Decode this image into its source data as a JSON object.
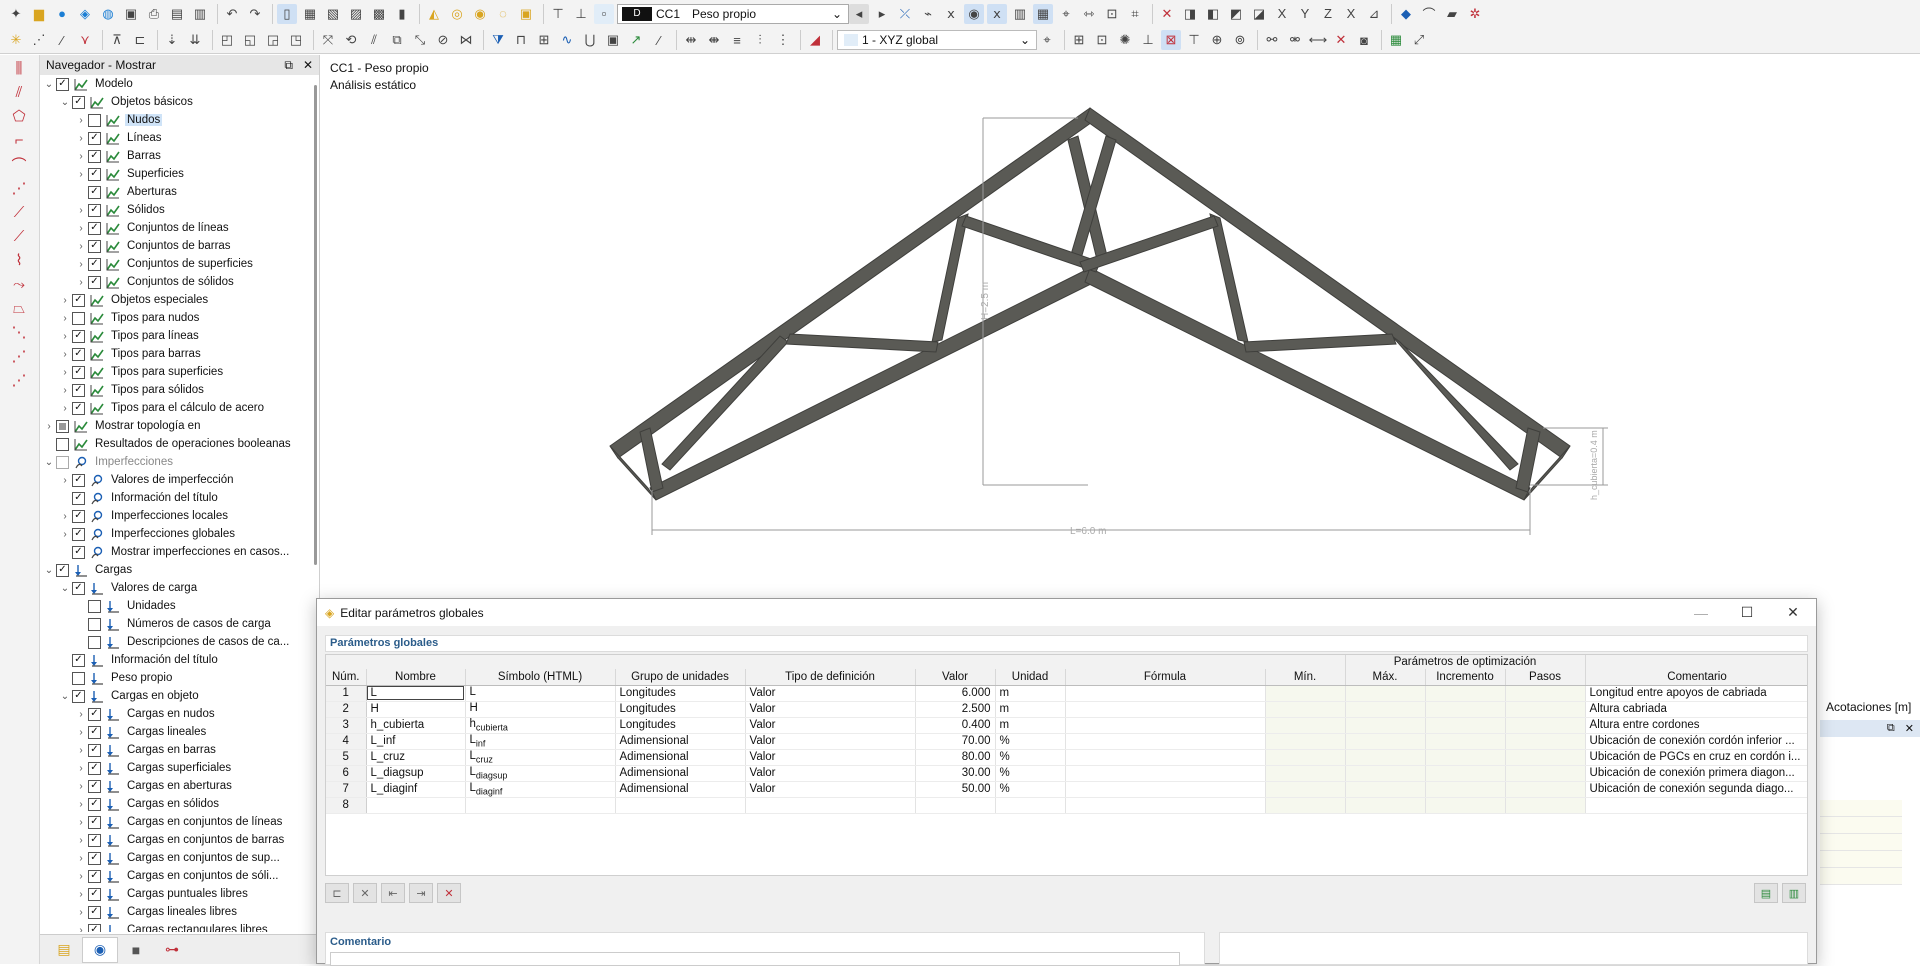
{
  "toolbar": {
    "load_case_code_badge": "D",
    "load_case_code": "CC1",
    "load_case_name": "Peso propio",
    "coord_system": "1 - XYZ global"
  },
  "navigator": {
    "title": "Navegador - Mostrar",
    "items": [
      {
        "label": "Modelo",
        "level": 0,
        "chevron": "down",
        "check": "on",
        "icon": "model"
      },
      {
        "label": "Objetos básicos",
        "level": 1,
        "chevron": "down",
        "check": "on",
        "icon": "model"
      },
      {
        "label": "Nudos",
        "level": 2,
        "chevron": "right",
        "check": "off",
        "icon": "model",
        "highlight": true
      },
      {
        "label": "Líneas",
        "level": 2,
        "chevron": "right",
        "check": "on",
        "icon": "model"
      },
      {
        "label": "Barras",
        "level": 2,
        "chevron": "right",
        "check": "on",
        "icon": "model"
      },
      {
        "label": "Superficies",
        "level": 2,
        "chevron": "right",
        "check": "on",
        "icon": "model"
      },
      {
        "label": "Aberturas",
        "level": 2,
        "chevron": "none",
        "check": "on",
        "icon": "model"
      },
      {
        "label": "Sólidos",
        "level": 2,
        "chevron": "right",
        "check": "on",
        "icon": "model"
      },
      {
        "label": "Conjuntos de líneas",
        "level": 2,
        "chevron": "right",
        "check": "on",
        "icon": "model"
      },
      {
        "label": "Conjuntos de barras",
        "level": 2,
        "chevron": "right",
        "check": "on",
        "icon": "model"
      },
      {
        "label": "Conjuntos de superficies",
        "level": 2,
        "chevron": "right",
        "check": "on",
        "icon": "model"
      },
      {
        "label": "Conjuntos de sólidos",
        "level": 2,
        "chevron": "right",
        "check": "on",
        "icon": "model"
      },
      {
        "label": "Objetos especiales",
        "level": 1,
        "chevron": "right",
        "check": "on",
        "icon": "model"
      },
      {
        "label": "Tipos para nudos",
        "level": 1,
        "chevron": "right",
        "check": "off",
        "icon": "model"
      },
      {
        "label": "Tipos para líneas",
        "level": 1,
        "chevron": "right",
        "check": "on",
        "icon": "model"
      },
      {
        "label": "Tipos para barras",
        "level": 1,
        "chevron": "right",
        "check": "on",
        "icon": "model"
      },
      {
        "label": "Tipos para superficies",
        "level": 1,
        "chevron": "right",
        "check": "on",
        "icon": "model"
      },
      {
        "label": "Tipos para sólidos",
        "level": 1,
        "chevron": "right",
        "check": "on",
        "icon": "model"
      },
      {
        "label": "Tipos para el cálculo de acero",
        "level": 1,
        "chevron": "right",
        "check": "on",
        "icon": "model"
      },
      {
        "label": "Mostrar topología en",
        "level": 0,
        "chevron": "right",
        "check": "part",
        "icon": "model"
      },
      {
        "label": "Resultados de operaciones booleanas",
        "level": 0,
        "chevron": "none",
        "check": "off",
        "icon": "model"
      },
      {
        "label": "Imperfecciones",
        "level": 0,
        "chevron": "down",
        "check": "gray",
        "icon": "imperf",
        "dim": true
      },
      {
        "label": "Valores de imperfección",
        "level": 1,
        "chevron": "right",
        "check": "on",
        "icon": "imperf"
      },
      {
        "label": "Información del título",
        "level": 1,
        "chevron": "none",
        "check": "on",
        "icon": "imperf"
      },
      {
        "label": "Imperfecciones locales",
        "level": 1,
        "chevron": "right",
        "check": "on",
        "icon": "imperf"
      },
      {
        "label": "Imperfecciones globales",
        "level": 1,
        "chevron": "right",
        "check": "on",
        "icon": "imperf"
      },
      {
        "label": "Mostrar imperfecciones en casos...",
        "level": 1,
        "chevron": "none",
        "check": "on",
        "icon": "imperf"
      },
      {
        "label": "Cargas",
        "level": 0,
        "chevron": "down",
        "check": "on",
        "icon": "load"
      },
      {
        "label": "Valores de carga",
        "level": 1,
        "chevron": "down",
        "check": "on",
        "icon": "load"
      },
      {
        "label": "Unidades",
        "level": 2,
        "chevron": "none",
        "check": "off",
        "icon": "load"
      },
      {
        "label": "Números de casos de carga",
        "level": 2,
        "chevron": "none",
        "check": "off",
        "icon": "load"
      },
      {
        "label": "Descripciones de casos de ca...",
        "level": 2,
        "chevron": "none",
        "check": "off",
        "icon": "load"
      },
      {
        "label": "Información del título",
        "level": 1,
        "chevron": "none",
        "check": "on",
        "icon": "load"
      },
      {
        "label": "Peso propio",
        "level": 1,
        "chevron": "none",
        "check": "off",
        "icon": "load"
      },
      {
        "label": "Cargas en objeto",
        "level": 1,
        "chevron": "down",
        "check": "on",
        "icon": "load"
      },
      {
        "label": "Cargas en nudos",
        "level": 2,
        "chevron": "right",
        "check": "on",
        "icon": "load"
      },
      {
        "label": "Cargas lineales",
        "level": 2,
        "chevron": "right",
        "check": "on",
        "icon": "load"
      },
      {
        "label": "Cargas en barras",
        "level": 2,
        "chevron": "right",
        "check": "on",
        "icon": "load"
      },
      {
        "label": "Cargas superficiales",
        "level": 2,
        "chevron": "right",
        "check": "on",
        "icon": "load"
      },
      {
        "label": "Cargas en aberturas",
        "level": 2,
        "chevron": "right",
        "check": "on",
        "icon": "load"
      },
      {
        "label": "Cargas en sólidos",
        "level": 2,
        "chevron": "right",
        "check": "on",
        "icon": "load"
      },
      {
        "label": "Cargas en conjuntos de líneas",
        "level": 2,
        "chevron": "right",
        "check": "on",
        "icon": "load"
      },
      {
        "label": "Cargas en conjuntos de barras",
        "level": 2,
        "chevron": "right",
        "check": "on",
        "icon": "load"
      },
      {
        "label": "Cargas en conjuntos de sup...",
        "level": 2,
        "chevron": "right",
        "check": "on",
        "icon": "load"
      },
      {
        "label": "Cargas en conjuntos de sóli...",
        "level": 2,
        "chevron": "right",
        "check": "on",
        "icon": "load"
      },
      {
        "label": "Cargas puntuales libres",
        "level": 2,
        "chevron": "right",
        "check": "on",
        "icon": "load"
      },
      {
        "label": "Cargas lineales libres",
        "level": 2,
        "chevron": "right",
        "check": "on",
        "icon": "load"
      },
      {
        "label": "Cargas rectangulares libres",
        "level": 2,
        "chevron": "right",
        "check": "on",
        "icon": "load"
      }
    ]
  },
  "viewport": {
    "info_line1": "CC1 - Peso propio",
    "info_line2": "Análisis estático",
    "dim_height": "H=2.5 m",
    "dim_length": "L=6.0 m",
    "dim_cover": "h_cubierta=0.4 m",
    "beam_color": "#5a5a55"
  },
  "right_panel": {
    "label": "Acotaciones [m]"
  },
  "dialog": {
    "title": "Editar parámetros globales",
    "section_title": "Parámetros globales",
    "optimization_group": "Parámetros de optimización",
    "columns": [
      "Núm.",
      "Nombre",
      "Símbolo (HTML)",
      "Grupo de unidades",
      "Tipo de definición",
      "Valor",
      "Unidad",
      "Fórmula",
      "Mín.",
      "Máx.",
      "Incremento",
      "Pasos",
      "Comentario"
    ],
    "rows": [
      {
        "num": "1",
        "name": "L",
        "sym": "L",
        "sub": "",
        "group": "Longitudes",
        "type": "Valor",
        "value": "6.000",
        "unit": "m",
        "comment": "Longitud entre apoyos de cabriada"
      },
      {
        "num": "2",
        "name": "H",
        "sym": "H",
        "sub": "",
        "group": "Longitudes",
        "type": "Valor",
        "value": "2.500",
        "unit": "m",
        "comment": "Altura cabriada"
      },
      {
        "num": "3",
        "name": "h_cubierta",
        "sym": "h",
        "sub": "cubierta",
        "group": "Longitudes",
        "type": "Valor",
        "value": "0.400",
        "unit": "m",
        "comment": "Altura entre cordones"
      },
      {
        "num": "4",
        "name": "L_inf",
        "sym": "L",
        "sub": "inf",
        "group": "Adimensional",
        "type": "Valor",
        "value": "70.00",
        "unit": "%",
        "comment": "Ubicación de conexión cordón inferior ..."
      },
      {
        "num": "5",
        "name": "L_cruz",
        "sym": "L",
        "sub": "cruz",
        "group": "Adimensional",
        "type": "Valor",
        "value": "80.00",
        "unit": "%",
        "comment": "Ubicación de PGCs en cruz en cordón i..."
      },
      {
        "num": "6",
        "name": "L_diagsup",
        "sym": "L",
        "sub": "diagsup",
        "group": "Adimensional",
        "type": "Valor",
        "value": "30.00",
        "unit": "%",
        "comment": "Ubicación de conexión primera diagon..."
      },
      {
        "num": "7",
        "name": "L_diaginf",
        "sym": "L",
        "sub": "diaginf",
        "group": "Adimensional",
        "type": "Valor",
        "value": "50.00",
        "unit": "%",
        "comment": "Ubicación de conexión segunda diago..."
      },
      {
        "num": "8",
        "name": "",
        "sym": "",
        "sub": "",
        "group": "",
        "type": "",
        "value": "",
        "unit": "",
        "comment": ""
      }
    ],
    "comment_section": "Comentario"
  }
}
